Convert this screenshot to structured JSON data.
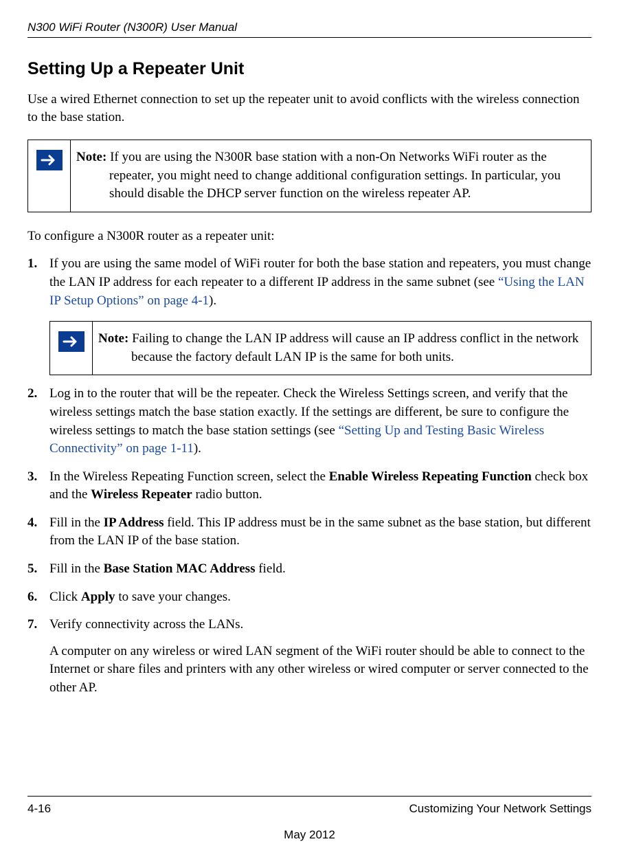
{
  "header": {
    "manual_title": "N300 WiFi Router (N300R) User Manual"
  },
  "section": {
    "heading": "Setting Up a Repeater Unit",
    "intro": "Use a wired Ethernet connection to set up the repeater unit to avoid conflicts with the wireless connection to the base station."
  },
  "note1": {
    "label": "Note:",
    "text": " If you are using the N300R base station with a non-On Networks WiFi router as the repeater, you might need to change additional configuration settings. In particular, you should disable the DHCP server function on the wireless repeater AP."
  },
  "pre_list": "To configure a N300R router as a repeater unit:",
  "steps": {
    "s1a": "If you are using the same model of WiFi router for both the base station and repeaters, you must change the LAN IP address for each repeater to a different IP address in the same subnet (see ",
    "s1_link": "“Using the LAN IP Setup Options” on page 4-1",
    "s1b": ").",
    "s2a": "Log in to the router that will be the repeater. Check the Wireless Settings screen, and verify that the wireless settings match the base station exactly. If the settings are different, be sure to configure the wireless settings to match the base station settings (see ",
    "s2_link": "“Setting Up and Testing Basic Wireless Connectivity” on page 1-11",
    "s2b": ").",
    "s3a": "In the Wireless Repeating Function screen, select the ",
    "s3_bold1": "Enable Wireless Repeating Function",
    "s3b": " check box and the ",
    "s3_bold2": "Wireless Repeater",
    "s3c": " radio button.",
    "s4a": "Fill in the ",
    "s4_bold": "IP Address",
    "s4b": " field. This IP address must be in the same subnet as the base station, but different from the LAN IP of the base station.",
    "s5a": "Fill in the ",
    "s5_bold": "Base Station MAC Address",
    "s5b": " field.",
    "s6a": "Click ",
    "s6_bold": "Apply",
    "s6b": " to save your changes.",
    "s7": "Verify connectivity across the LANs.",
    "s7_sub": "A computer on any wireless or wired LAN segment of the WiFi router should be able to connect to the Internet or share files and printers with any other wireless or wired computer or server connected to the other AP."
  },
  "note2": {
    "label": "Note:",
    "text": " Failing to change the LAN IP address will cause an IP address conflict in the network because the factory default LAN IP is the same for both units."
  },
  "footer": {
    "page": "4-16",
    "chapter": "Customizing Your Network Settings",
    "date": "May 2012"
  }
}
